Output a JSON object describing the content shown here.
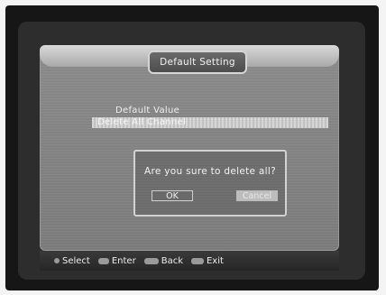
{
  "window": {
    "title": "Default Setting"
  },
  "menu": {
    "items": [
      {
        "label": "Default Value"
      },
      {
        "label": "Delete All Channel"
      }
    ]
  },
  "dialog": {
    "message": "Are you sure to delete all?",
    "ok_label": "OK",
    "cancel_label": "Cancel"
  },
  "footer": {
    "items": [
      {
        "label": "Select",
        "icon": "dot-icon"
      },
      {
        "label": "Enter",
        "icon": "ok-key-icon"
      },
      {
        "label": "Back",
        "icon": "menu-key-icon"
      },
      {
        "label": "Exit",
        "icon": "exit-key-icon"
      }
    ]
  }
}
